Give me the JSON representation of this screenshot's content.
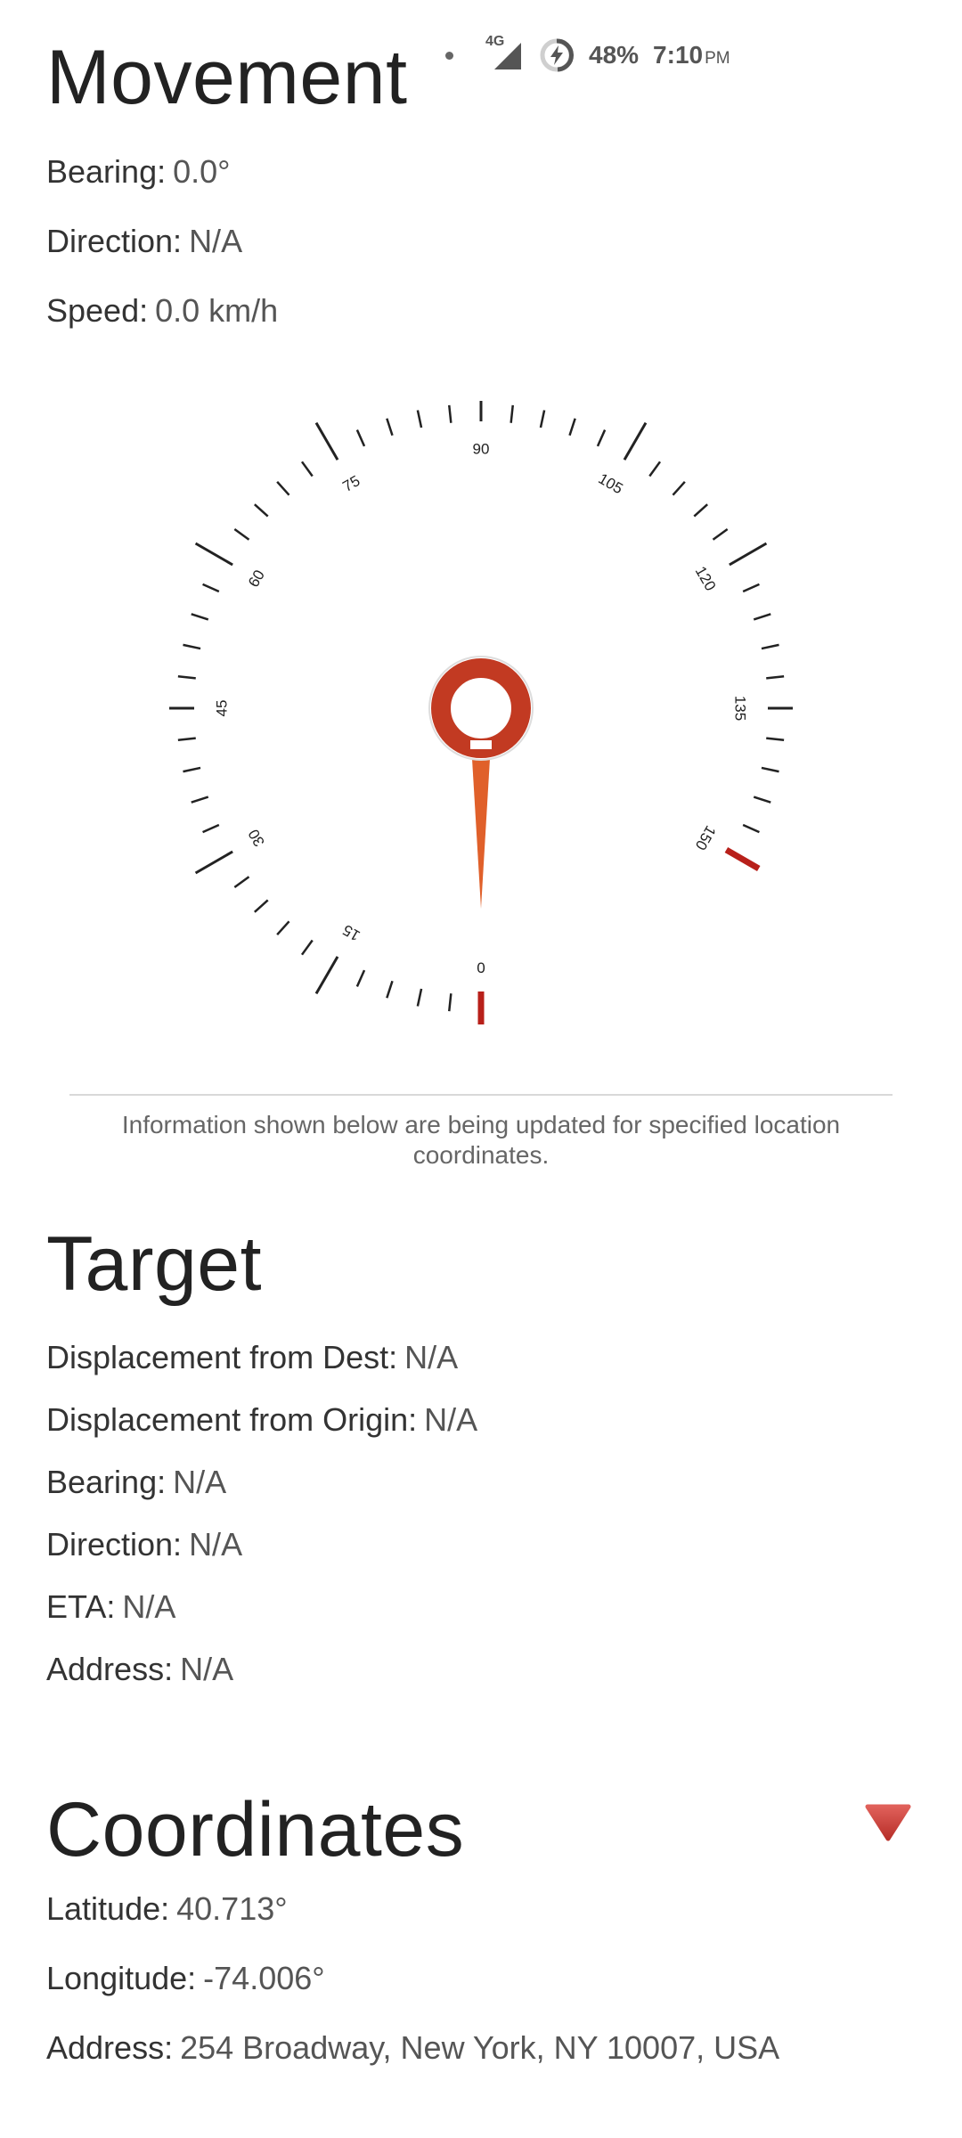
{
  "status_bar": {
    "network": "4G",
    "battery": "48%",
    "time": "7:10",
    "ampm": "PM"
  },
  "movement": {
    "title": "Movement",
    "rows": [
      {
        "label": "Bearing:",
        "value": "0.0°"
      },
      {
        "label": "Direction:",
        "value": "N/A"
      },
      {
        "label": "Speed:",
        "value": "0.0 km/h"
      }
    ]
  },
  "speedometer": {
    "min": 0,
    "max": 150,
    "value": 0,
    "major_step": 15,
    "minor_step": 3,
    "ticks": [
      "0",
      "15",
      "30",
      "45",
      "60",
      "75",
      "90",
      "105",
      "120",
      "135",
      "150"
    ],
    "needle_color": "#e0602a",
    "hub_color": "#c23a22",
    "redline_color": "#b8201a"
  },
  "info_note": "Information shown below are being updated for specified location coordinates.",
  "target": {
    "title": "Target",
    "rows": [
      {
        "label": "Displacement from Dest:",
        "value": "N/A"
      },
      {
        "label": "Displacement from Origin:",
        "value": "N/A"
      },
      {
        "label": "Bearing:",
        "value": "N/A"
      },
      {
        "label": "Direction:",
        "value": "N/A"
      },
      {
        "label": "ETA:",
        "value": "N/A"
      },
      {
        "label": "Address:",
        "value": "N/A"
      }
    ]
  },
  "coordinates": {
    "title": "Coordinates",
    "collapse_icon": "triangle-down-icon",
    "accent_color": "#c9403a",
    "rows": [
      {
        "label": "Latitude:",
        "value": "40.713°"
      },
      {
        "label": "Longitude:",
        "value": "-74.006°"
      },
      {
        "label": "Address:",
        "value": "254 Broadway, New York, NY 10007, USA"
      }
    ]
  }
}
